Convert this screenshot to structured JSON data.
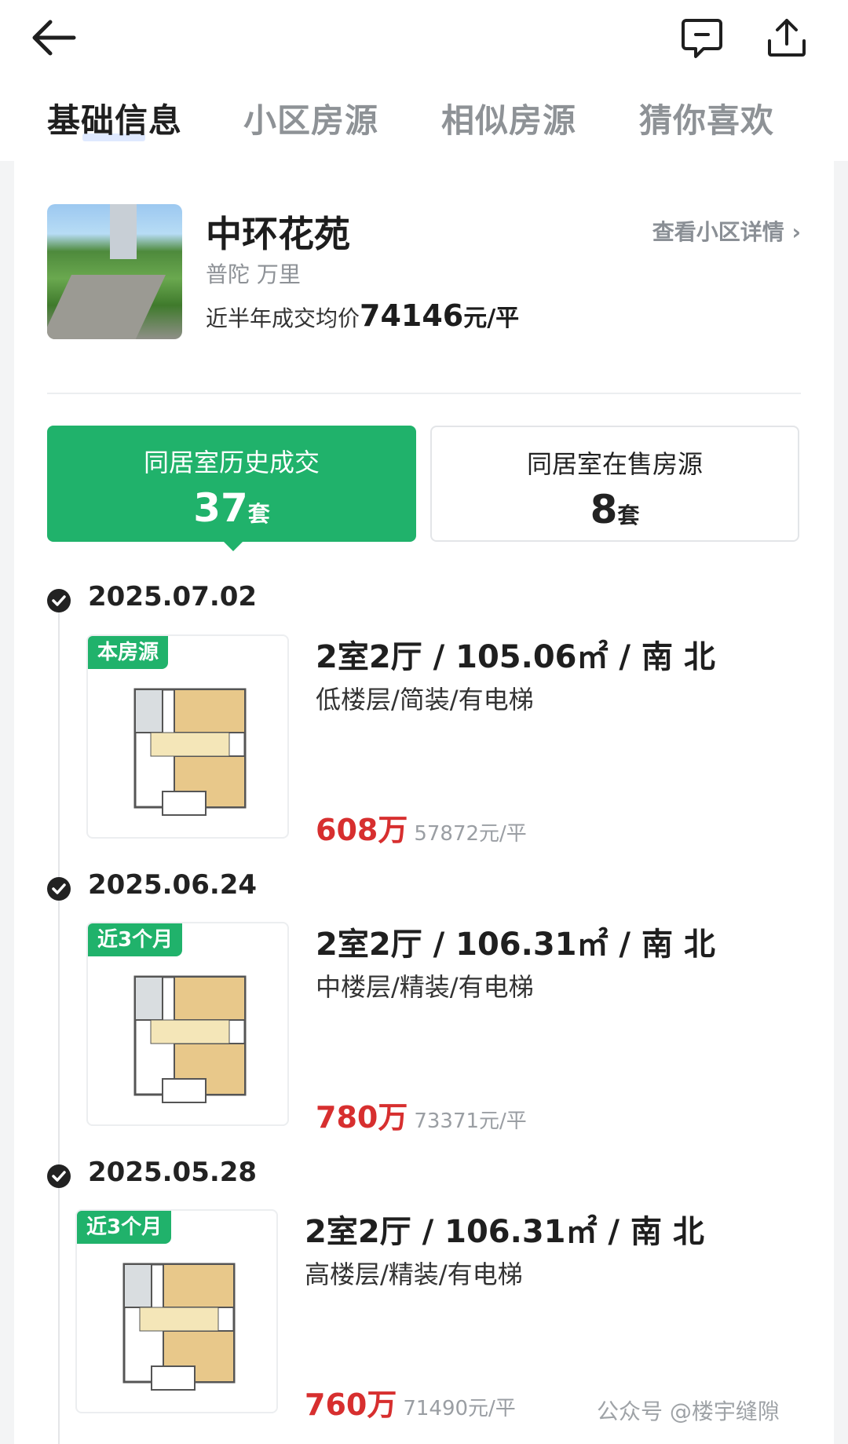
{
  "tabs": [
    "基础信息",
    "小区房源",
    "相似房源",
    "猜你喜欢"
  ],
  "community": {
    "name": "中环花苑",
    "region": "普陀 万里",
    "avg_label": "近半年成交均价",
    "avg_price": "74146",
    "avg_unit": "元/平",
    "detail_link": "查看小区详情 ›"
  },
  "stats": {
    "sold_label": "同居室历史成交",
    "sold_count": "37",
    "sale_label": "同居室在售房源",
    "sale_count": "8",
    "suffix": "套"
  },
  "records": [
    {
      "date": "2025.07.02",
      "tag": "本房源",
      "title": "2室2厅 / 105.06㎡ / 南 北",
      "sub": "低楼层/简装/有电梯",
      "price": "608万",
      "unit_price": "57872元/平"
    },
    {
      "date": "2025.06.24",
      "tag": "近3个月",
      "title": "2室2厅 / 106.31㎡ / 南 北",
      "sub": "中楼层/精装/有电梯",
      "price": "780万",
      "unit_price": "73371元/平"
    },
    {
      "date": "2025.05.28",
      "tag": "近3个月",
      "title": "2室2厅 / 106.31㎡ / 南 北",
      "sub": "高楼层/精装/有电梯",
      "price": "760万",
      "unit_price": "71490元/平"
    }
  ],
  "watermark": "公众号 @楼宇缝隙",
  "colors": {
    "accent": "#20b26b",
    "price": "#d72f2f"
  }
}
